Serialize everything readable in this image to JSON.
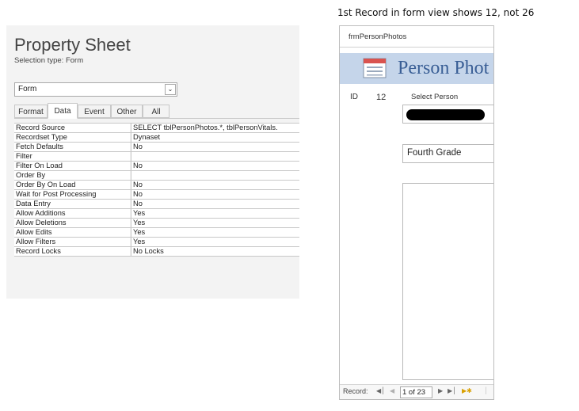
{
  "caption": "1st Record in form view shows 12, not 26",
  "property_sheet": {
    "title": "Property Sheet",
    "selection_type": "Selection type:  Form",
    "object_dropdown": {
      "value": "Form",
      "icon": "chevron-down-icon"
    },
    "tabs": [
      {
        "label": "Format",
        "active": false
      },
      {
        "label": "Data",
        "active": true
      },
      {
        "label": "Event",
        "active": false
      },
      {
        "label": "Other",
        "active": false
      },
      {
        "label": "All",
        "active": false
      }
    ],
    "rows": [
      {
        "name": "Record Source",
        "value": "SELECT tblPersonPhotos.*, tblPersonVitals."
      },
      {
        "name": "Recordset Type",
        "value": "Dynaset"
      },
      {
        "name": "Fetch Defaults",
        "value": "No"
      },
      {
        "name": "Filter",
        "value": ""
      },
      {
        "name": "Filter On Load",
        "value": "No"
      },
      {
        "name": "Order By",
        "value": ""
      },
      {
        "name": "Order By On Load",
        "value": "No"
      },
      {
        "name": "Wait for Post Processing",
        "value": "No"
      },
      {
        "name": "Data Entry",
        "value": "No"
      },
      {
        "name": "Allow Additions",
        "value": "Yes"
      },
      {
        "name": "Allow Deletions",
        "value": "Yes"
      },
      {
        "name": "Allow Edits",
        "value": "Yes"
      },
      {
        "name": "Allow Filters",
        "value": "Yes"
      },
      {
        "name": "Record Locks",
        "value": "No Locks"
      }
    ]
  },
  "form_view": {
    "doc_tab": "frmPersonPhotos",
    "header_title": "Person Phot",
    "header_icon": "form-icon",
    "id_label": "ID",
    "id_value": "12",
    "select_person_label": "Select Person",
    "grade_value": "Fourth Grade",
    "navigation": {
      "record_label": "Record:",
      "counter": "1 of 23"
    },
    "colors": {
      "header_bg": "#c5d5ea",
      "title": "#3a5f96"
    }
  }
}
